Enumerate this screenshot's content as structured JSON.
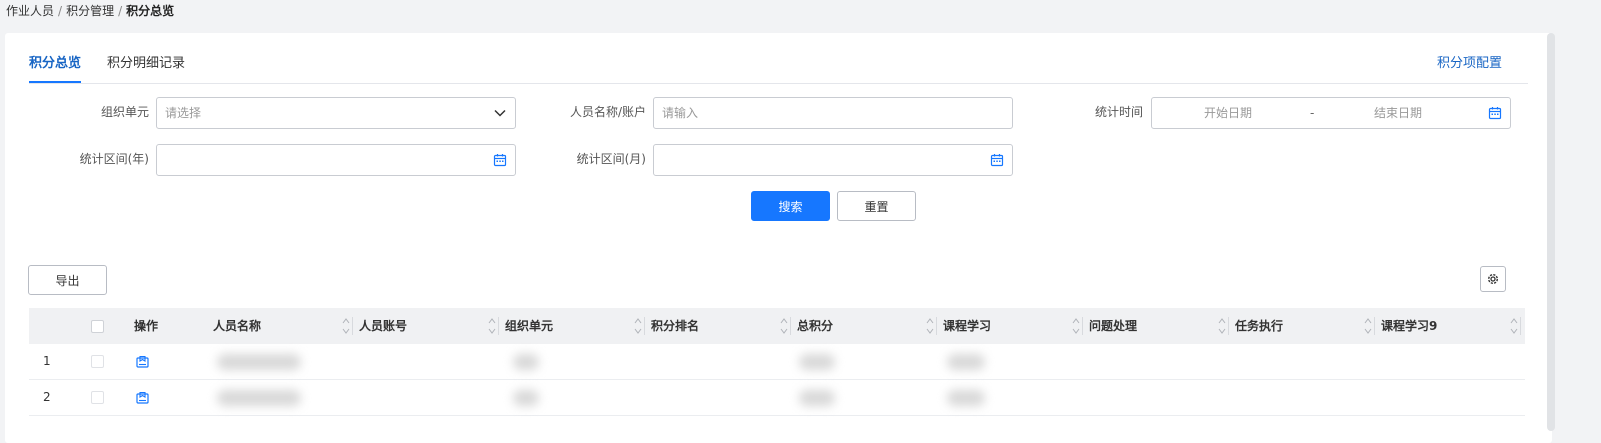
{
  "breadcrumb": {
    "items": [
      "作业人员",
      "积分管理"
    ],
    "current": "积分总览",
    "separator": "/"
  },
  "tabs": [
    {
      "label": "积分总览",
      "active": true
    },
    {
      "label": "积分明细记录",
      "active": false
    }
  ],
  "config_link": "积分项配置",
  "filters": {
    "org_unit": {
      "label": "组织单元",
      "placeholder": "请选择"
    },
    "person": {
      "label": "人员名称/账户",
      "placeholder": "请输入"
    },
    "stat_time": {
      "label": "统计时间",
      "start_placeholder": "开始日期",
      "dash": "-",
      "end_placeholder": "结束日期"
    },
    "year_range": {
      "label": "统计区间(年)",
      "value": ""
    },
    "month_range": {
      "label": "统计区间(月)",
      "value": ""
    }
  },
  "actions": {
    "search": "搜索",
    "reset": "重置",
    "export": "导出"
  },
  "table": {
    "columns": [
      "操作",
      "人员名称",
      "人员账号",
      "组织单元",
      "积分排名",
      "总积分",
      "课程学习",
      "问题处理",
      "任务执行",
      "课程学习9"
    ],
    "rows": [
      {
        "index": "1"
      },
      {
        "index": "2"
      }
    ]
  },
  "colors": {
    "accent": "#1677ff",
    "link": "#1865c4",
    "header_bg": "#f0f1f3"
  },
  "icons": [
    "chevron-down-icon",
    "calendar-icon",
    "gear-icon",
    "checkbox-icon",
    "edit-icon",
    "sort-icon"
  ]
}
